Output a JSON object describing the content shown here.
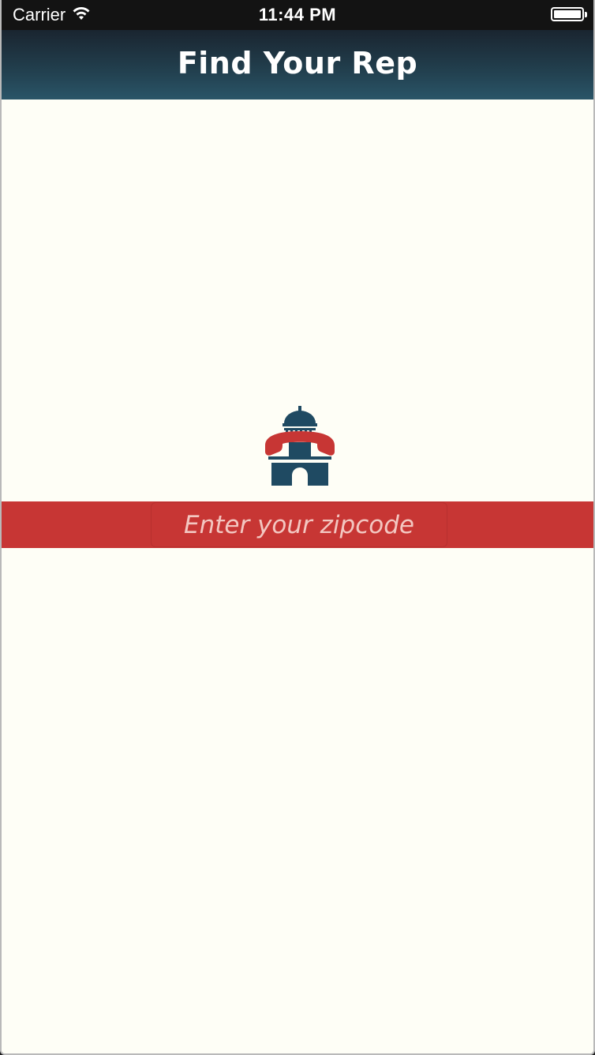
{
  "status_bar": {
    "carrier": "Carrier",
    "time": "11:44 PM",
    "wifi_icon": "wifi-icon",
    "battery_icon": "battery-icon"
  },
  "nav": {
    "title": "Find Your Rep"
  },
  "logo": {
    "icon": "capitol-phone-icon"
  },
  "zip": {
    "placeholder": "Enter your zipcode",
    "value": ""
  },
  "colors": {
    "accent_red": "#c73634",
    "navy": "#1f4a62",
    "background": "#fefef6"
  }
}
